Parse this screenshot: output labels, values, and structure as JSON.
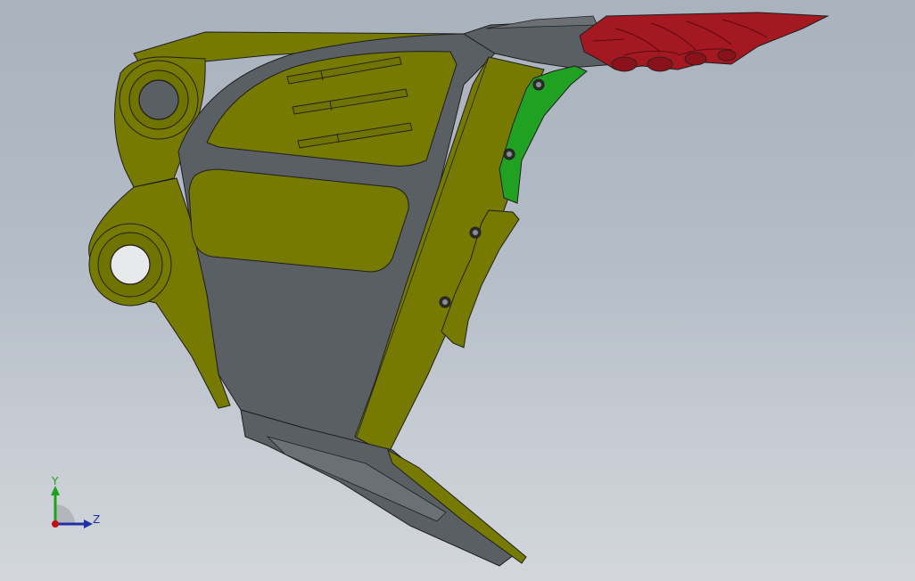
{
  "viewport": {
    "background_top": "#a9b2bd",
    "background_bottom": "#d3d7dc"
  },
  "model": {
    "part_colors": {
      "body": "#767a00",
      "body_dark": "#5c5f00",
      "plate": "#5a5f63",
      "plate_light": "#6b7075",
      "wear_plate": "#21a121",
      "teeth": "#a31821",
      "outline": "#1f1f1f"
    }
  },
  "triad": {
    "y_label": "Y",
    "z_label": "Z",
    "y_color": "#1aa31a",
    "z_color": "#1f2ea8",
    "origin_color": "#c41010"
  }
}
